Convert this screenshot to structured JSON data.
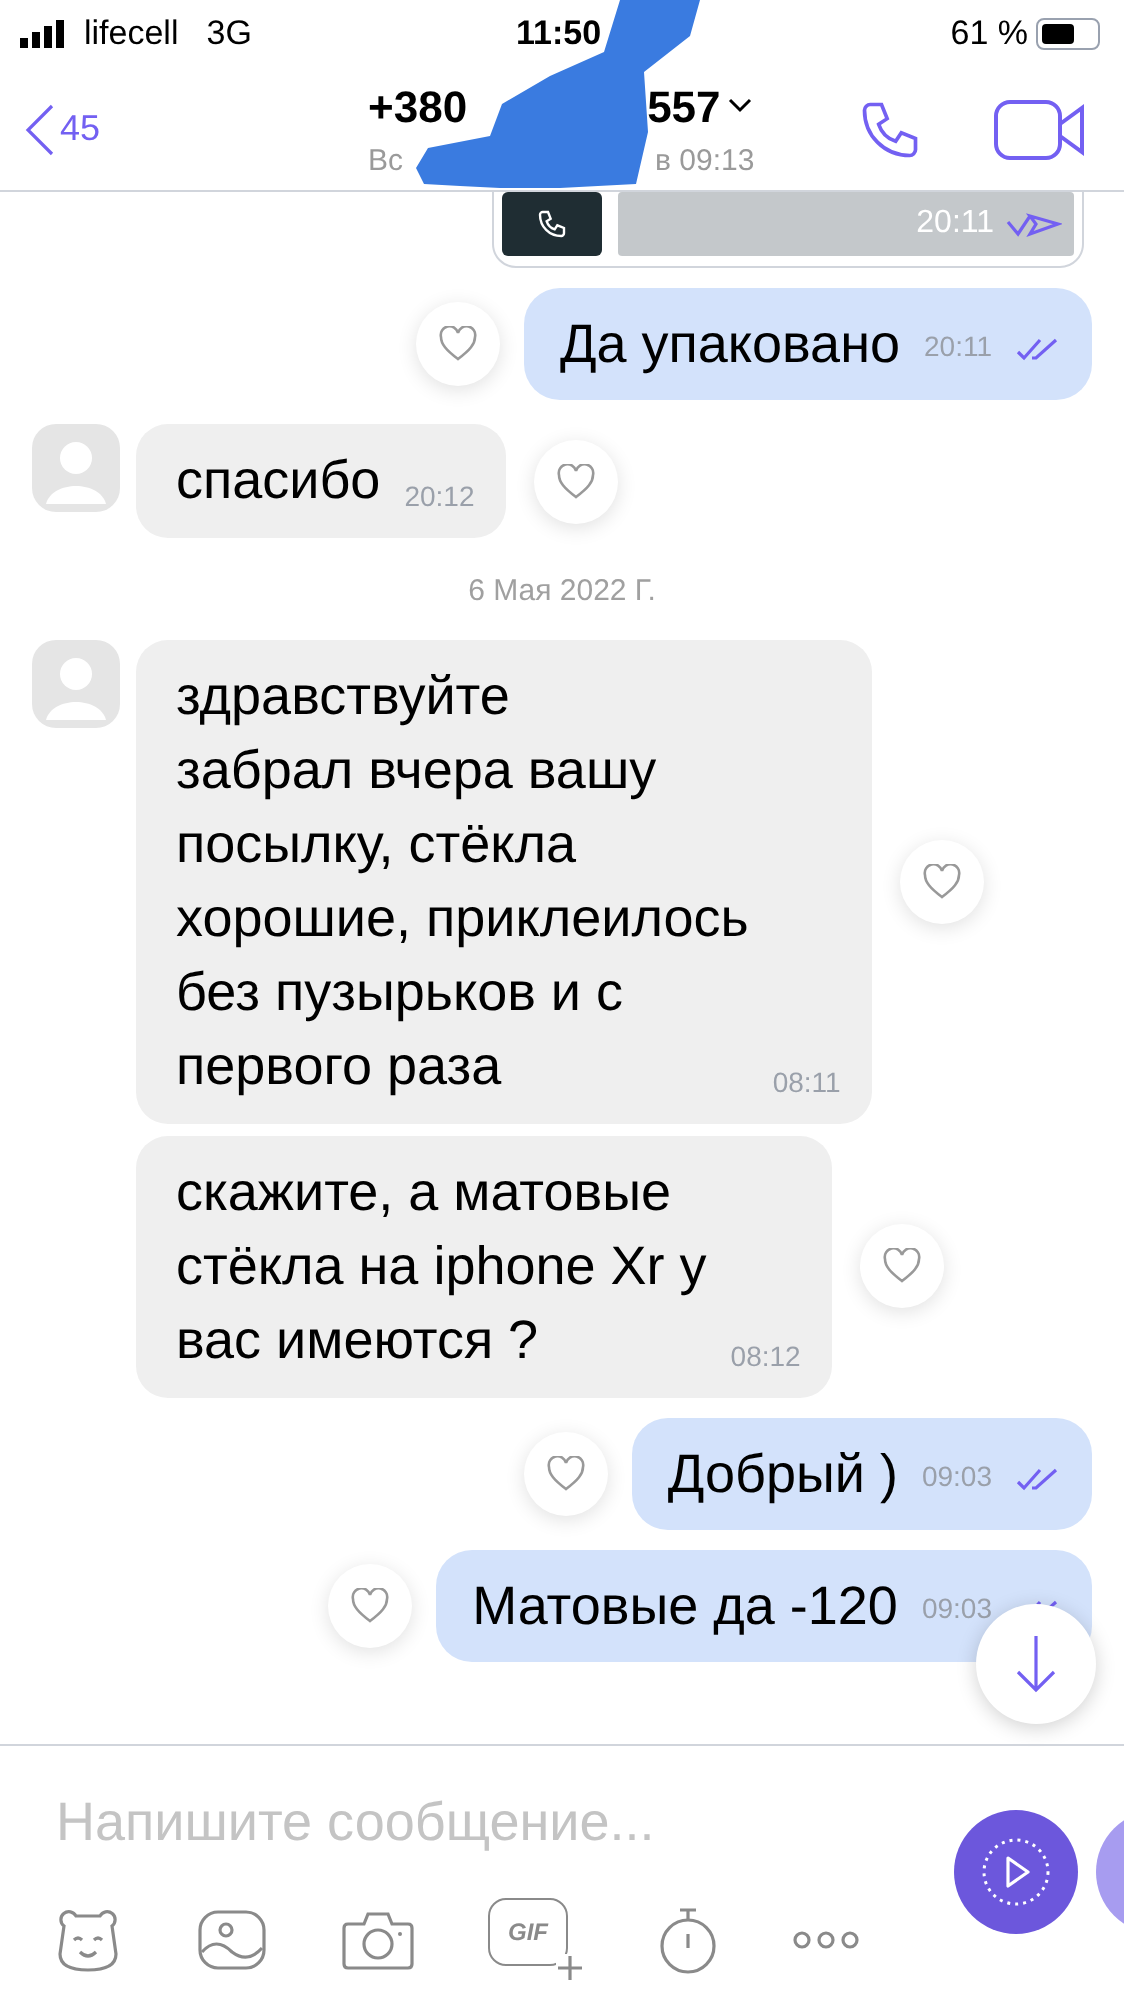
{
  "status_bar": {
    "carrier": "lifecell",
    "network": "3G",
    "time": "11:50",
    "battery": "61 %"
  },
  "header": {
    "back_count": "45",
    "title_start": "+380",
    "title_end": "557",
    "status_start": "Вс",
    "status_end": "в 09:13"
  },
  "messages": [
    {
      "kind": "call-card",
      "time": "20:11"
    },
    {
      "kind": "outgoing",
      "text": "Да упаковано",
      "time": "20:11"
    },
    {
      "kind": "incoming",
      "text": "спасибо",
      "time": "20:12",
      "avatar": true
    },
    {
      "kind": "date",
      "text": "6 Мая 2022 Г."
    },
    {
      "kind": "incoming",
      "text": "здравствуйте\nзабрал вчера вашу\nпосылку, стёкла\nхорошие, приклеилось\nбез пузырьков и с\nпервого раза",
      "time": "08:11",
      "avatar": true
    },
    {
      "kind": "incoming",
      "text": "скажите, а матовые\nстёкла на iphone Xr у\nвас имеются ?",
      "time": "08:12",
      "avatar": false
    },
    {
      "kind": "outgoing",
      "text": "Добрый )",
      "time": "09:03"
    },
    {
      "kind": "outgoing",
      "text": "Матовые да -120",
      "time": "09:03"
    }
  ],
  "composer": {
    "placeholder": "Напишите сообщение..."
  },
  "toolbar": [
    {
      "kind": "sticker"
    },
    {
      "kind": "gallery"
    },
    {
      "kind": "camera"
    },
    {
      "kind": "gif",
      "label": "GIF"
    },
    {
      "kind": "timer"
    },
    {
      "kind": "more"
    }
  ]
}
